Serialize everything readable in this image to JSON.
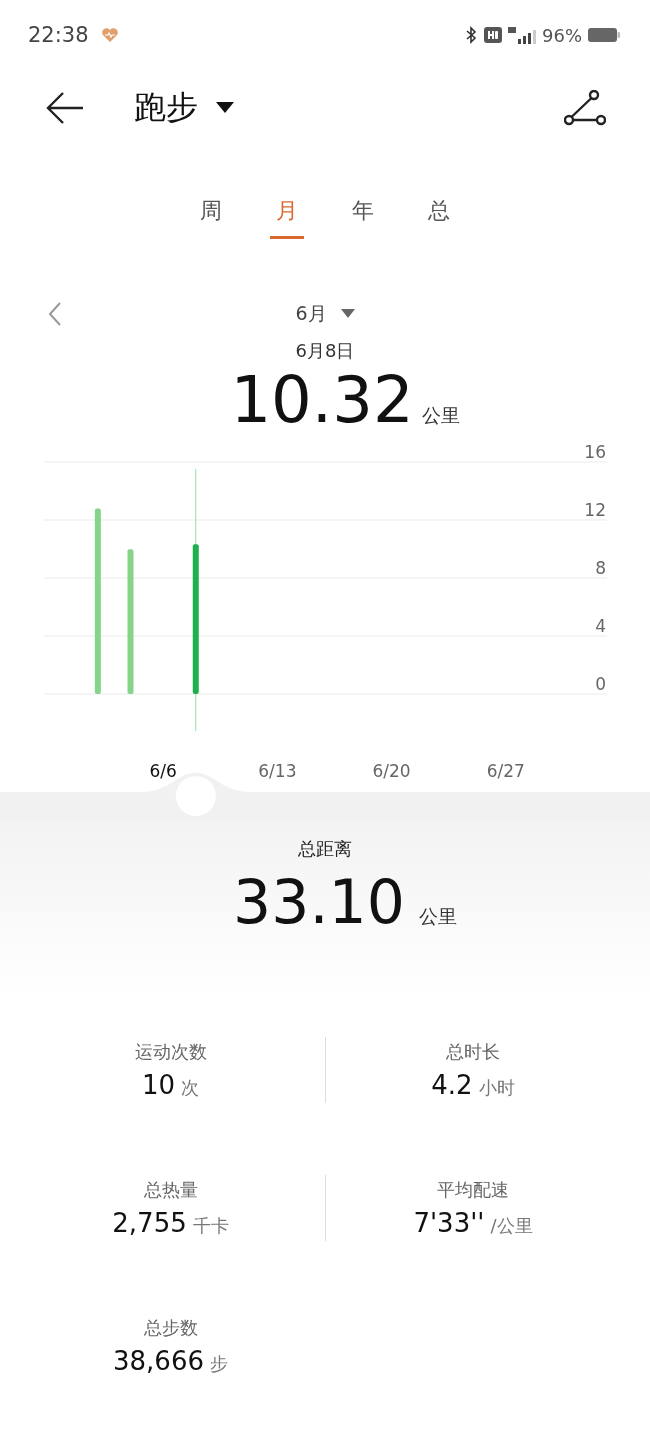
{
  "status_bar": {
    "time": "22:38",
    "battery": "96%"
  },
  "header": {
    "title": "跑步"
  },
  "tabs": [
    {
      "label": "周",
      "selected": false
    },
    {
      "label": "月",
      "selected": true
    },
    {
      "label": "年",
      "selected": false
    },
    {
      "label": "总",
      "selected": false
    }
  ],
  "period": {
    "label": "6月"
  },
  "selected_point": {
    "date": "6月8日",
    "value": "10.32",
    "unit": "公里"
  },
  "chart_data": {
    "type": "bar",
    "stacked": true,
    "categories": [
      null,
      null,
      null,
      null,
      null,
      "6/6",
      null,
      null,
      null,
      null,
      null,
      null,
      "6/13",
      null,
      null,
      null,
      null,
      null,
      null,
      "6/20",
      null,
      null,
      null,
      null,
      null,
      null,
      "6/27",
      null,
      null,
      null
    ],
    "series": [
      {
        "color": "#86d48a",
        "values": [
          null,
          12.8,
          null,
          9.98,
          null,
          null,
          null,
          null,
          null,
          null,
          null,
          null,
          null,
          null,
          null,
          null,
          null,
          null,
          null,
          null,
          null,
          null,
          null,
          null,
          null,
          null,
          null,
          null,
          null,
          null
        ]
      },
      {
        "color": "#1db04c",
        "values": [
          null,
          null,
          null,
          null,
          null,
          null,
          null,
          10.32,
          null,
          null,
          null,
          null,
          null,
          null,
          null,
          null,
          null,
          null,
          null,
          null,
          null,
          null,
          null,
          null,
          null,
          null,
          null,
          null,
          null,
          null
        ]
      }
    ],
    "ylim": [
      0,
      16
    ],
    "yticks": [
      0,
      4,
      8,
      12,
      16
    ],
    "grid": true
  },
  "total": {
    "label": "总距离",
    "value": "33.10",
    "unit": "公里"
  },
  "stats": [
    {
      "label": "运动次数",
      "value": "10",
      "unit": "次"
    },
    {
      "label": "总时长",
      "value": "4.2",
      "unit": "小时"
    },
    {
      "label": "总热量",
      "value": "2,755",
      "unit": "千卡"
    },
    {
      "label": "平均配速",
      "value": "7'33''",
      "unit": "/公里"
    },
    {
      "label": "总步数",
      "value": "38,666",
      "unit": "步"
    }
  ]
}
